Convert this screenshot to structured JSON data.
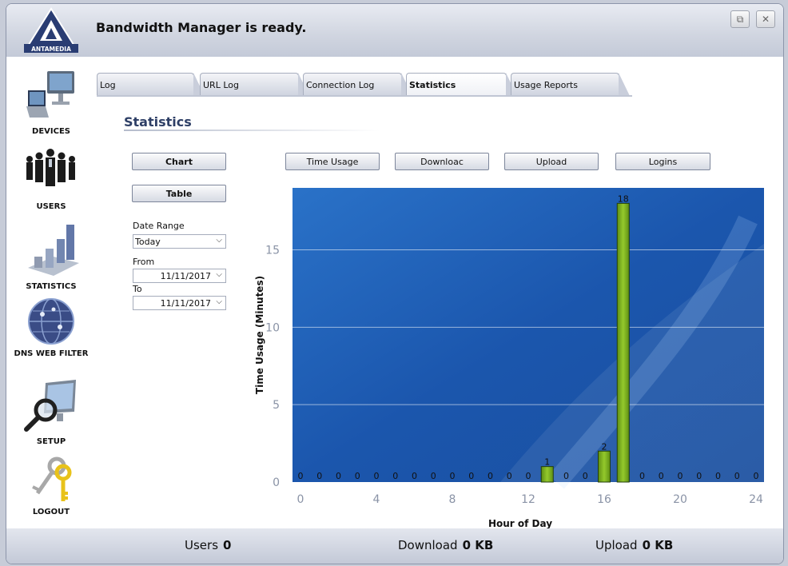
{
  "window": {
    "status_title": "Bandwidth Manager is ready.",
    "logo_text": "ANTAMEDIA",
    "restore_glyph": "⧉",
    "close_glyph": "✕"
  },
  "sidebar": {
    "items": [
      {
        "label": "DEVICES",
        "icon": "computer-icon"
      },
      {
        "label": "USERS",
        "icon": "people-icon"
      },
      {
        "label": "STATISTICS",
        "icon": "bar-chart-icon"
      },
      {
        "label": "DNS WEB FILTER",
        "icon": "globe-icon"
      },
      {
        "label": "SETUP",
        "icon": "magnifier-monitor-icon"
      },
      {
        "label": "LOGOUT",
        "icon": "keys-icon"
      }
    ]
  },
  "tabs": [
    {
      "label": "Log"
    },
    {
      "label": "URL Log"
    },
    {
      "label": "Connection Log"
    },
    {
      "label": "Statistics"
    },
    {
      "label": "Usage Reports"
    }
  ],
  "statistics": {
    "title": "Statistics",
    "chart_button": "Chart",
    "table_button": "Table",
    "date_range_label": "Date Range",
    "date_range_value": "Today",
    "from_label": "From",
    "from_value": "11/11/2017",
    "to_label": "To",
    "to_value": "11/11/2017",
    "metric_buttons": [
      "Time Usage",
      "Downloac",
      "Upload",
      "Logins"
    ]
  },
  "chart_data": {
    "type": "bar",
    "x": [
      0,
      1,
      2,
      3,
      4,
      5,
      6,
      7,
      8,
      9,
      10,
      11,
      12,
      13,
      14,
      15,
      16,
      17,
      18,
      19,
      20,
      21,
      22,
      23,
      24
    ],
    "values": [
      0,
      0,
      0,
      0,
      0,
      0,
      0,
      0,
      0,
      0,
      0,
      0,
      0,
      1,
      0,
      0,
      2,
      18,
      0,
      0,
      0,
      0,
      0,
      0,
      0
    ],
    "xlabel": "Hour of Day",
    "ylabel": "Time Usage (Minutes)",
    "xticks": [
      0,
      4,
      8,
      12,
      16,
      20,
      24
    ],
    "yticks": [
      0,
      5,
      10,
      15
    ],
    "ylim": [
      0,
      19
    ],
    "xlim": [
      0,
      24
    ],
    "grid": true,
    "colors": {
      "bar": "#7fb51d",
      "background": "#1f5fb8"
    }
  },
  "status": {
    "users_label": "Users",
    "users_value": "0",
    "download_label": "Download",
    "download_value": "0 KB",
    "upload_label": "Upload",
    "upload_value": "0 KB"
  }
}
